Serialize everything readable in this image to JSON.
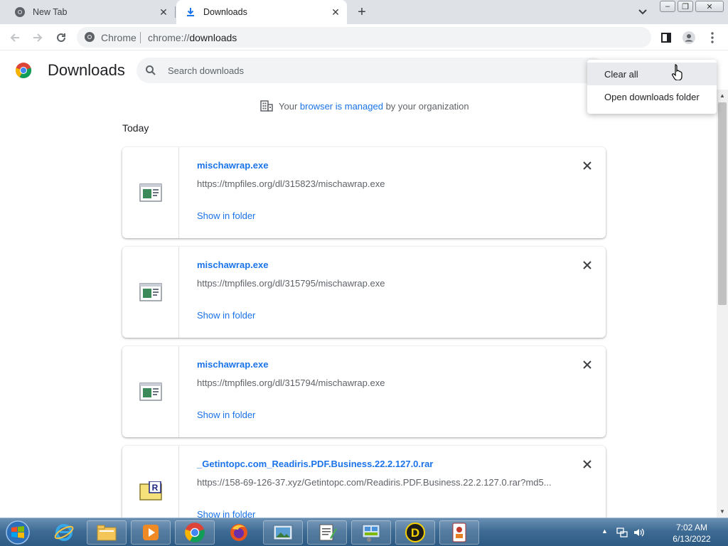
{
  "browser": {
    "tabs": [
      {
        "title": "New Tab"
      },
      {
        "title": "Downloads"
      }
    ],
    "omnibox": {
      "scheme_label": "Chrome",
      "url_prefix": "chrome://",
      "url_path": "downloads"
    }
  },
  "downloads_page": {
    "title": "Downloads",
    "search_placeholder": "Search downloads",
    "managed_notice": {
      "prefix": "Your ",
      "link": "browser is managed",
      "suffix": " by your organization"
    },
    "section_label": "Today",
    "items": [
      {
        "filename": "mischawrap.exe",
        "url": "https://tmpfiles.org/dl/315823/mischawrap.exe",
        "action": "Show in folder",
        "icon": "exe-file-icon"
      },
      {
        "filename": "mischawrap.exe",
        "url": "https://tmpfiles.org/dl/315795/mischawrap.exe",
        "action": "Show in folder",
        "icon": "exe-file-icon"
      },
      {
        "filename": "mischawrap.exe",
        "url": "https://tmpfiles.org/dl/315794/mischawrap.exe",
        "action": "Show in folder",
        "icon": "exe-file-icon"
      },
      {
        "filename": "_Getintopc.com_Readiris.PDF.Business.22.2.127.0.rar",
        "url": "https://158-69-126-37.xyz/Getintopc.com/Readiris.PDF.Business.22.2.127.0.rar?md5...",
        "action": "Show in folder",
        "icon": "rar-file-icon"
      }
    ]
  },
  "menu": {
    "items": [
      {
        "label": "Clear all",
        "hovered": true
      },
      {
        "label": "Open downloads folder",
        "hovered": false
      }
    ]
  },
  "taskbar": {
    "apps": [
      "internet-explorer",
      "file-explorer",
      "media-player",
      "chrome",
      "firefox",
      "photo-viewer",
      "notepad-editor",
      "control-panel",
      "d-app",
      "card-app"
    ],
    "clock": {
      "time": "7:02 AM",
      "date": "6/13/2022"
    }
  },
  "colors": {
    "accent": "#1a73e8",
    "tabstrip": "#dee1e6",
    "taskbar": "#3f6c95"
  }
}
